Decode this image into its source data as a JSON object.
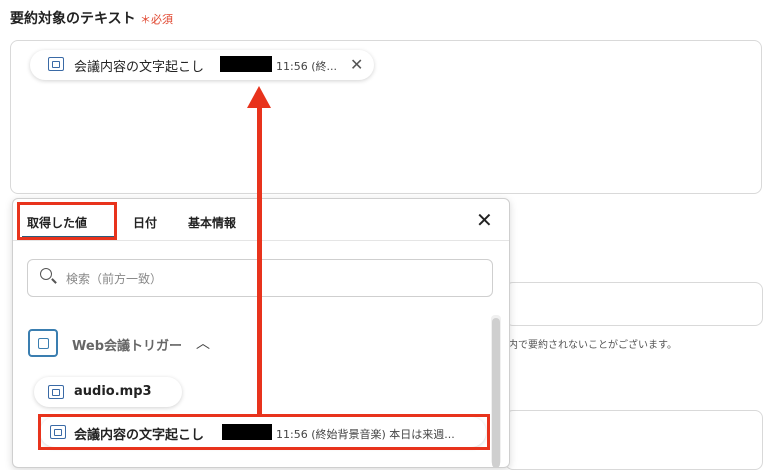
{
  "field": {
    "label": "要約対象のテキスト",
    "required": "＊必須"
  },
  "selected_chip": {
    "label": "会議内容の文字起こし",
    "time": "11:56 (終..."
  },
  "background": {
    "note": "内で要約されないことがございます。"
  },
  "panel": {
    "tabs": [
      {
        "label": "取得した値"
      },
      {
        "label": "日付"
      },
      {
        "label": "基本情報"
      }
    ],
    "search": {
      "placeholder": "検索（前方一致）"
    },
    "trigger": {
      "label": "Web会議トリガー"
    },
    "items": [
      {
        "label": "audio.mp3"
      },
      {
        "label": "会議内容の文字起こし",
        "time": "11:56 (終始背景音楽) 本日は来週..."
      }
    ]
  },
  "colors": {
    "highlight": "#e8331c",
    "accent": "#2b5b7a",
    "icon": "#3a6aa6"
  }
}
